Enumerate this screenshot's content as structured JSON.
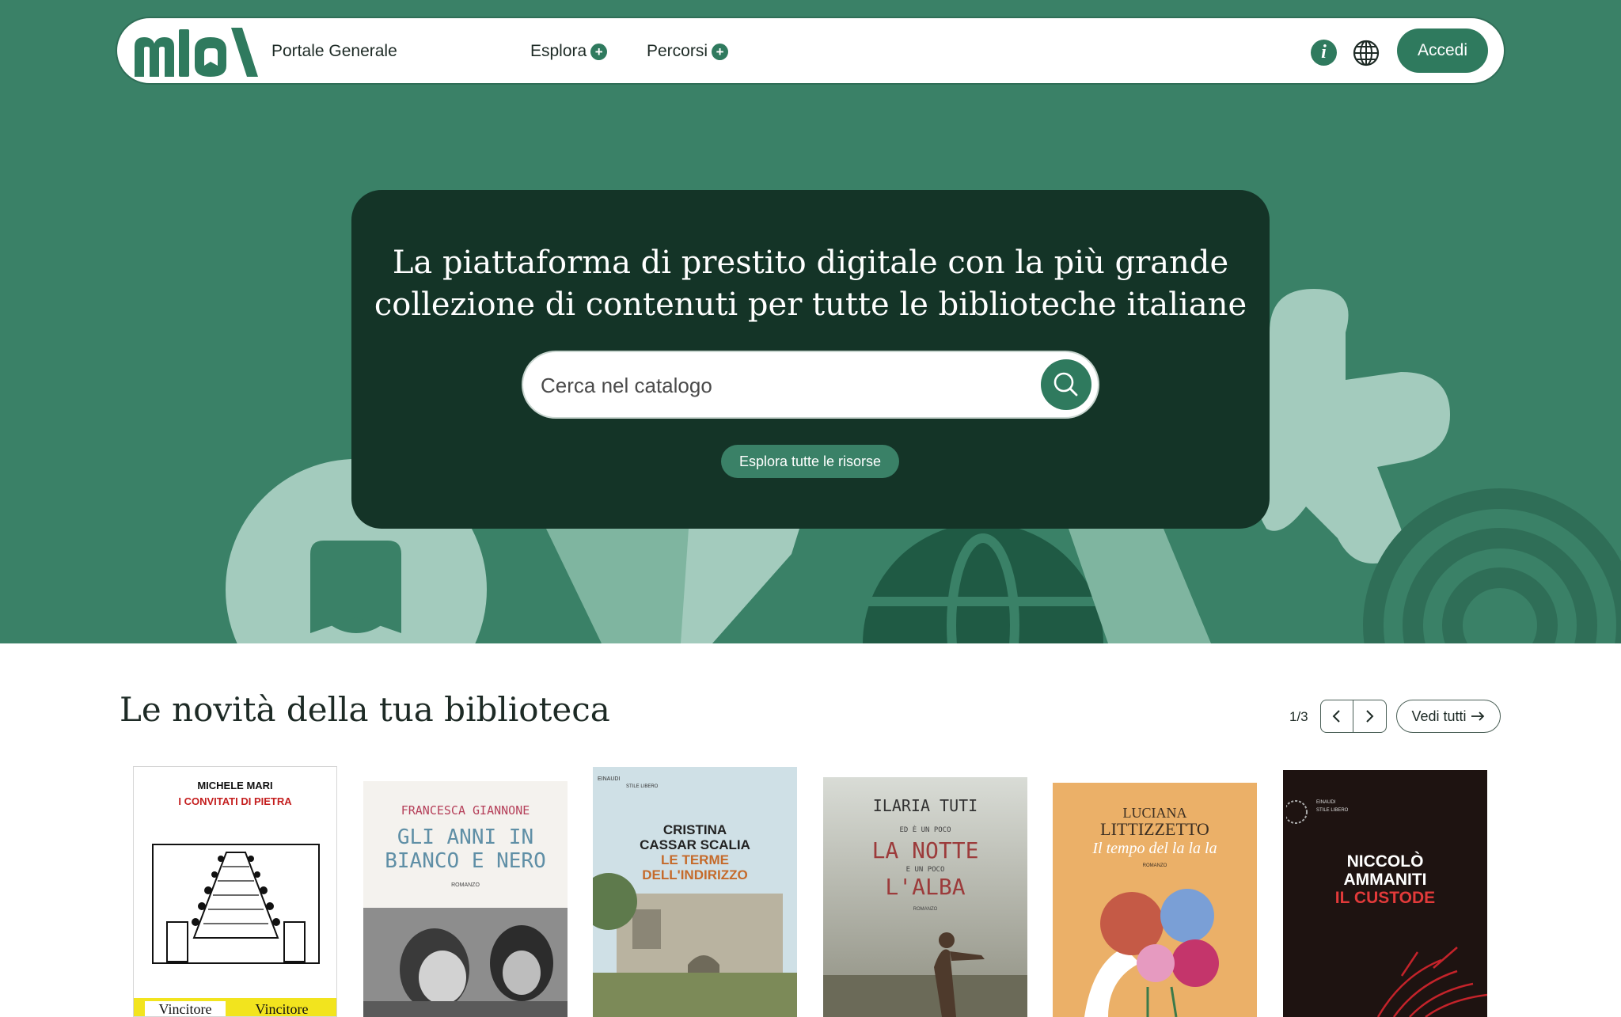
{
  "nav": {
    "logo_text": "mlol",
    "portal_name": "Portale Generale",
    "menu": [
      {
        "label": "Esplora"
      },
      {
        "label": "Percorsi"
      }
    ],
    "info_icon": "info-icon",
    "globe_icon": "globe-icon",
    "login_label": "Accedi"
  },
  "hero": {
    "headline_line1": "La piattaforma di prestito digitale con la più grande",
    "headline_line2": "collezione di contenuti per tutte le biblioteche italiane",
    "search_placeholder": "Cerca nel catalogo",
    "explore_label": "Esplora tutte le risorse"
  },
  "news": {
    "title": "Le novità della tua biblioteca",
    "pager": "1/3",
    "see_all_label": "Vedi tutti",
    "books": [
      {
        "author": "MICHELE MARI",
        "title": "I CONVITATI DI PIETRA",
        "badge1": "Vincitore",
        "badge2": "Vincitore"
      },
      {
        "author": "FRANCESCA GIANNONE",
        "title1": "GLI ANNI IN",
        "title2": "BIANCO E NERO",
        "subtitle": "ROMANZO"
      },
      {
        "author1": "CRISTINA",
        "author2": "CASSAR SCALIA",
        "title1": "LE TERME",
        "title2": "DELL'INDIRIZZO",
        "publisher": "EINAUDI",
        "series": "STILE LIBERO"
      },
      {
        "author": "ILARIA TUTI",
        "line1": "ED È UN POCO",
        "title1": "LA NOTTE",
        "line2": "E UN POCO",
        "title2": "L'ALBA",
        "subtitle": "ROMANZO"
      },
      {
        "author1": "LUCIANA",
        "author2": "LITTIZZETTO",
        "title": "Il tempo del la la la",
        "subtitle": "ROMANZO"
      },
      {
        "author1": "NICCOLÒ",
        "author2": "AMMANITI",
        "title": "IL CUSTODE",
        "publisher": "EINAUDI",
        "series": "STILE LIBERO"
      }
    ]
  },
  "colors": {
    "hero_bg": "#3a8167",
    "card_bg": "#143427",
    "accent": "#2f7a5e",
    "shape_light": "#a3cbbd"
  }
}
